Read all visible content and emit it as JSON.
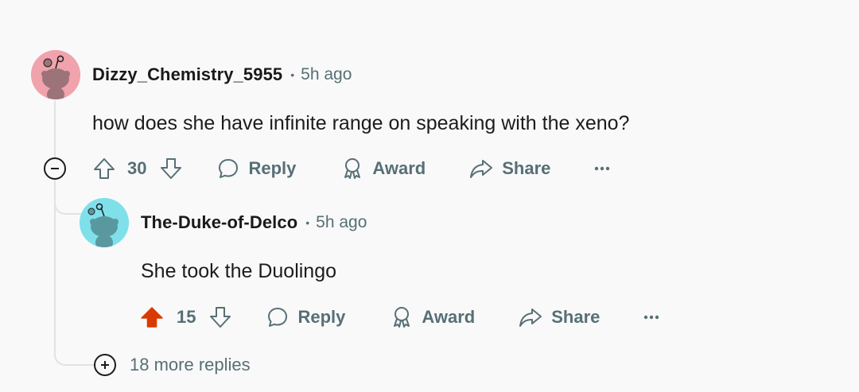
{
  "comment1": {
    "username": "Dizzy_Chemistry_5955",
    "separator": "•",
    "time": "5h ago",
    "text": "how does she have infinite range on speaking with the xeno?",
    "votes": "30",
    "reply_label": "Reply",
    "award_label": "Award",
    "share_label": "Share",
    "avatar_color": "#f0a3ad",
    "upvoted": false
  },
  "comment2": {
    "username": "The-Duke-of-Delco",
    "separator": "•",
    "time": "5h ago",
    "text": "She took the Duolingo",
    "votes": "15",
    "reply_label": "Reply",
    "award_label": "Award",
    "share_label": "Share",
    "avatar_color": "#7fe0ea",
    "upvoted": true,
    "upvote_color": "#d93a00"
  },
  "more_replies": {
    "label": "18 more replies"
  }
}
